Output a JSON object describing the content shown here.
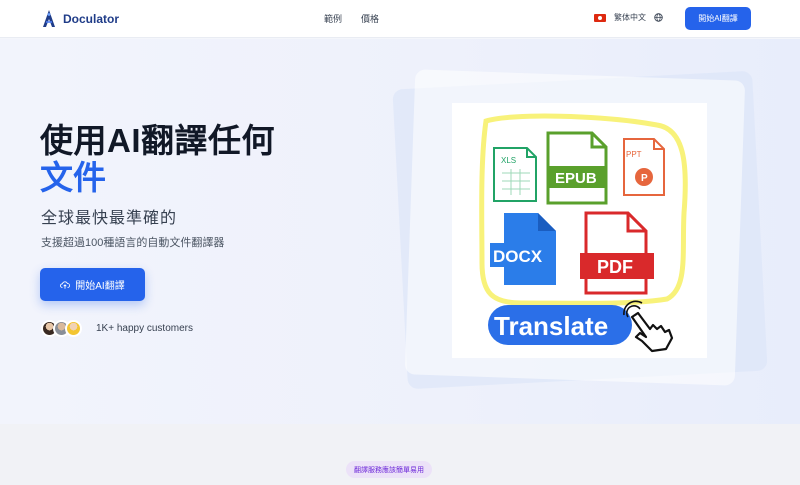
{
  "header": {
    "brand": "Doculator",
    "nav": [
      "範例",
      "價格"
    ],
    "language": "繁体中文",
    "cta_label": "開始AI翻譯"
  },
  "hero": {
    "title_line1": "使用AI翻譯任何",
    "title_line2": "文件",
    "subtitle": "全球最快最準確的",
    "description": "支援超過100種語言的自動文件翻譯器",
    "cta_label": "開始AI翻譯",
    "social_proof": "1K+ happy customers"
  },
  "illustration": {
    "file_labels": [
      "XLS",
      "EPUB",
      "PPT",
      "DOCX",
      "PDF"
    ],
    "button_text": "Translate"
  },
  "section": {
    "badge": "翻譯服務應該簡單易用"
  },
  "colors": {
    "primary": "#2563eb",
    "accent_title": "#2563eb",
    "badge_bg": "#ece2f8",
    "badge_text": "#6d28d9"
  },
  "icons": [
    "logo-icon",
    "flag-icon",
    "globe-icon",
    "upload-cloud-icon",
    "hand-pointer-icon"
  ]
}
